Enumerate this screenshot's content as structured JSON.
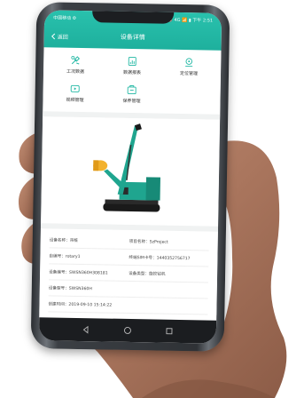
{
  "status_bar": {
    "left": "中国移动 ⚙",
    "right": "⏰ 4G 📶 ▮ 下午 2:51"
  },
  "header": {
    "back_label": "返回",
    "title": "设备详情"
  },
  "menu": [
    {
      "label": "工况数据",
      "icon": "tools-icon"
    },
    {
      "label": "数据报表",
      "icon": "report-icon"
    },
    {
      "label": "定位管理",
      "icon": "location-icon"
    },
    {
      "label": "视频管理",
      "icon": "video-icon"
    },
    {
      "label": "保养管理",
      "icon": "maintenance-icon"
    }
  ],
  "info": {
    "rows": [
      {
        "left": "设备名称：吊桩",
        "right": "项目名称：SzProject"
      },
      {
        "left": "自编号：rotary1",
        "right": "终端SIM卡号：1440352756717"
      },
      {
        "left": "设备编号：SWSN360H308181",
        "right": "设备类型：旋挖钻机"
      },
      {
        "left": "设备型号：SWSN360H",
        "right": ""
      },
      {
        "left": "创建时间：2019-09-10 15:14:22",
        "right": ""
      }
    ]
  },
  "colors": {
    "accent": "#22b8a4",
    "machine": "#1fa58f"
  }
}
